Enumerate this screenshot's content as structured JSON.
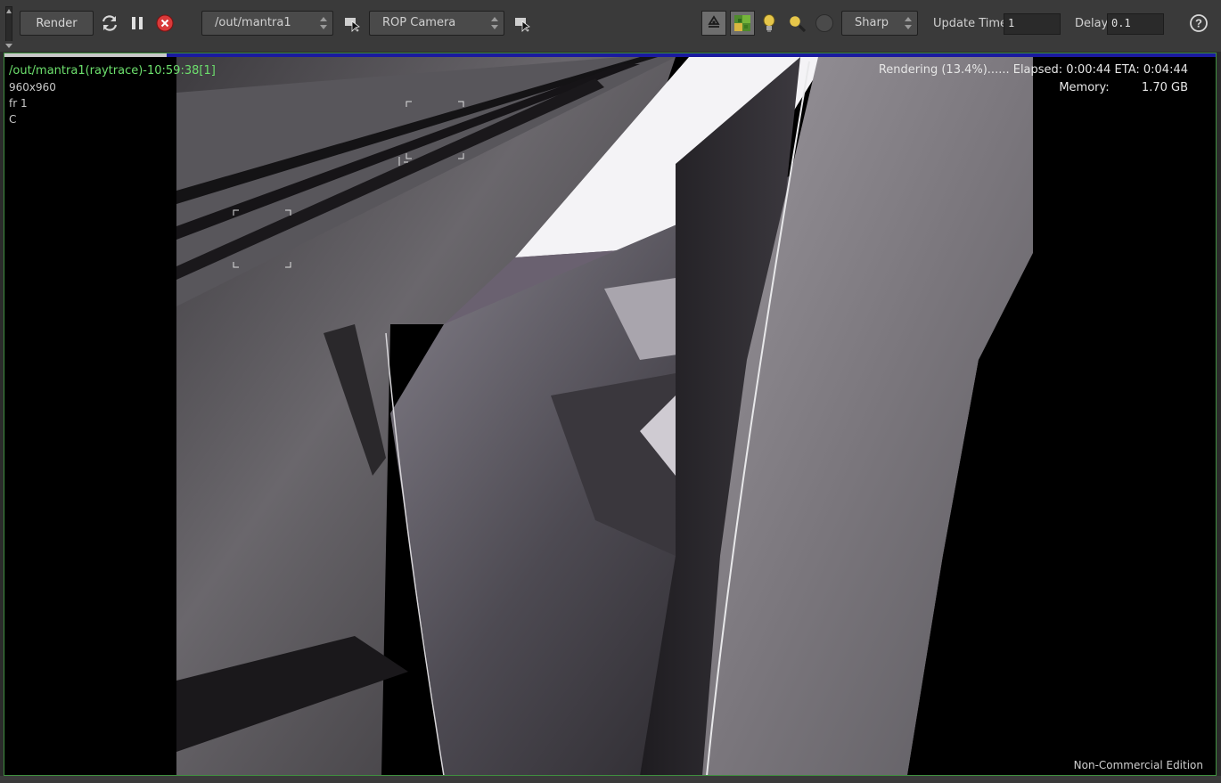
{
  "toolbar": {
    "render_label": "Render",
    "output_path": "/out/mantra1",
    "camera": "ROP Camera",
    "filter_mode": "Sharp",
    "update_time_label": "Update Time",
    "update_time_value": "1",
    "delay_label": "Delay",
    "delay_value": "0.1",
    "help_symbol": "?"
  },
  "icons": {
    "refresh": "refresh-icon",
    "pause": "pause-icon",
    "stop": "stop-icon",
    "pick_output": "pick-node-icon",
    "pick_camera": "pick-camera-icon",
    "preview": "recycle-preview-icon",
    "pixel_sampling": "pixel-sampling-icon",
    "light": "lightbulb-icon",
    "zoom": "magnifier-icon",
    "sphere": "sphere-icon"
  },
  "hud": {
    "title": "/out/mantra1(raytrace)-10:59:38[1]",
    "resolution": "960x960",
    "frame": "fr 1",
    "channel": "C",
    "status": "Rendering (13.4%)...... Elapsed: 0:00:44   ETA: 0:04:44",
    "memory_label": "Memory:",
    "memory_value": "1.70 GB",
    "edition": "Non-Commercial Edition"
  },
  "progress": {
    "fraction": 0.134
  },
  "colors": {
    "progress_bar": "#1a1aa0",
    "hud_title": "#6de06d",
    "stop_button": "#d93a3a",
    "viewport_border": "#3f8f3f"
  }
}
